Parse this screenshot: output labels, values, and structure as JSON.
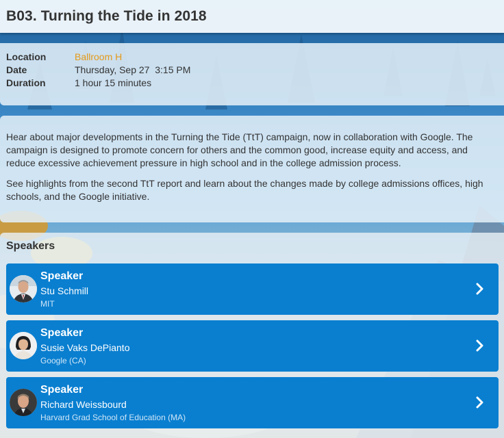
{
  "session": {
    "title": "B03. Turning the Tide in 2018"
  },
  "info": {
    "location_label": "Location",
    "location_value": "Ballroom H",
    "date_label": "Date",
    "date_value": "Thursday, Sep 27  3:15 PM",
    "duration_label": "Duration",
    "duration_value": "1 hour 15 minutes"
  },
  "description": {
    "paragraph_1": "Hear about major developments in the Turning the Tide (TtT) campaign, now in collaboration with Google. The campaign is designed to promote concern for others and the common good, increase equity and access, and reduce excessive achievement pressure in high school and in the college admission process.",
    "paragraph_2": "See highlights from the second TtT report and learn about the changes made by college admissions offices, high schools, and the Google initiative."
  },
  "speakers": {
    "heading": "Speakers",
    "items": [
      {
        "role": "Speaker",
        "name": "Stu Schmill",
        "org": "MIT",
        "icon": "chevron-right-icon"
      },
      {
        "role": "Speaker",
        "name": "Susie Vaks DePianto",
        "org": "Google (CA)",
        "icon": "chevron-right-icon"
      },
      {
        "role": "Speaker",
        "name": "Richard Weissbourd",
        "org": "Harvard Grad School of Education (MA)",
        "icon": "chevron-right-icon"
      }
    ]
  },
  "colors": {
    "card_blue": "#0a7fd0",
    "link_orange": "#e49a1a",
    "panel_tint": "#e1eef7"
  }
}
